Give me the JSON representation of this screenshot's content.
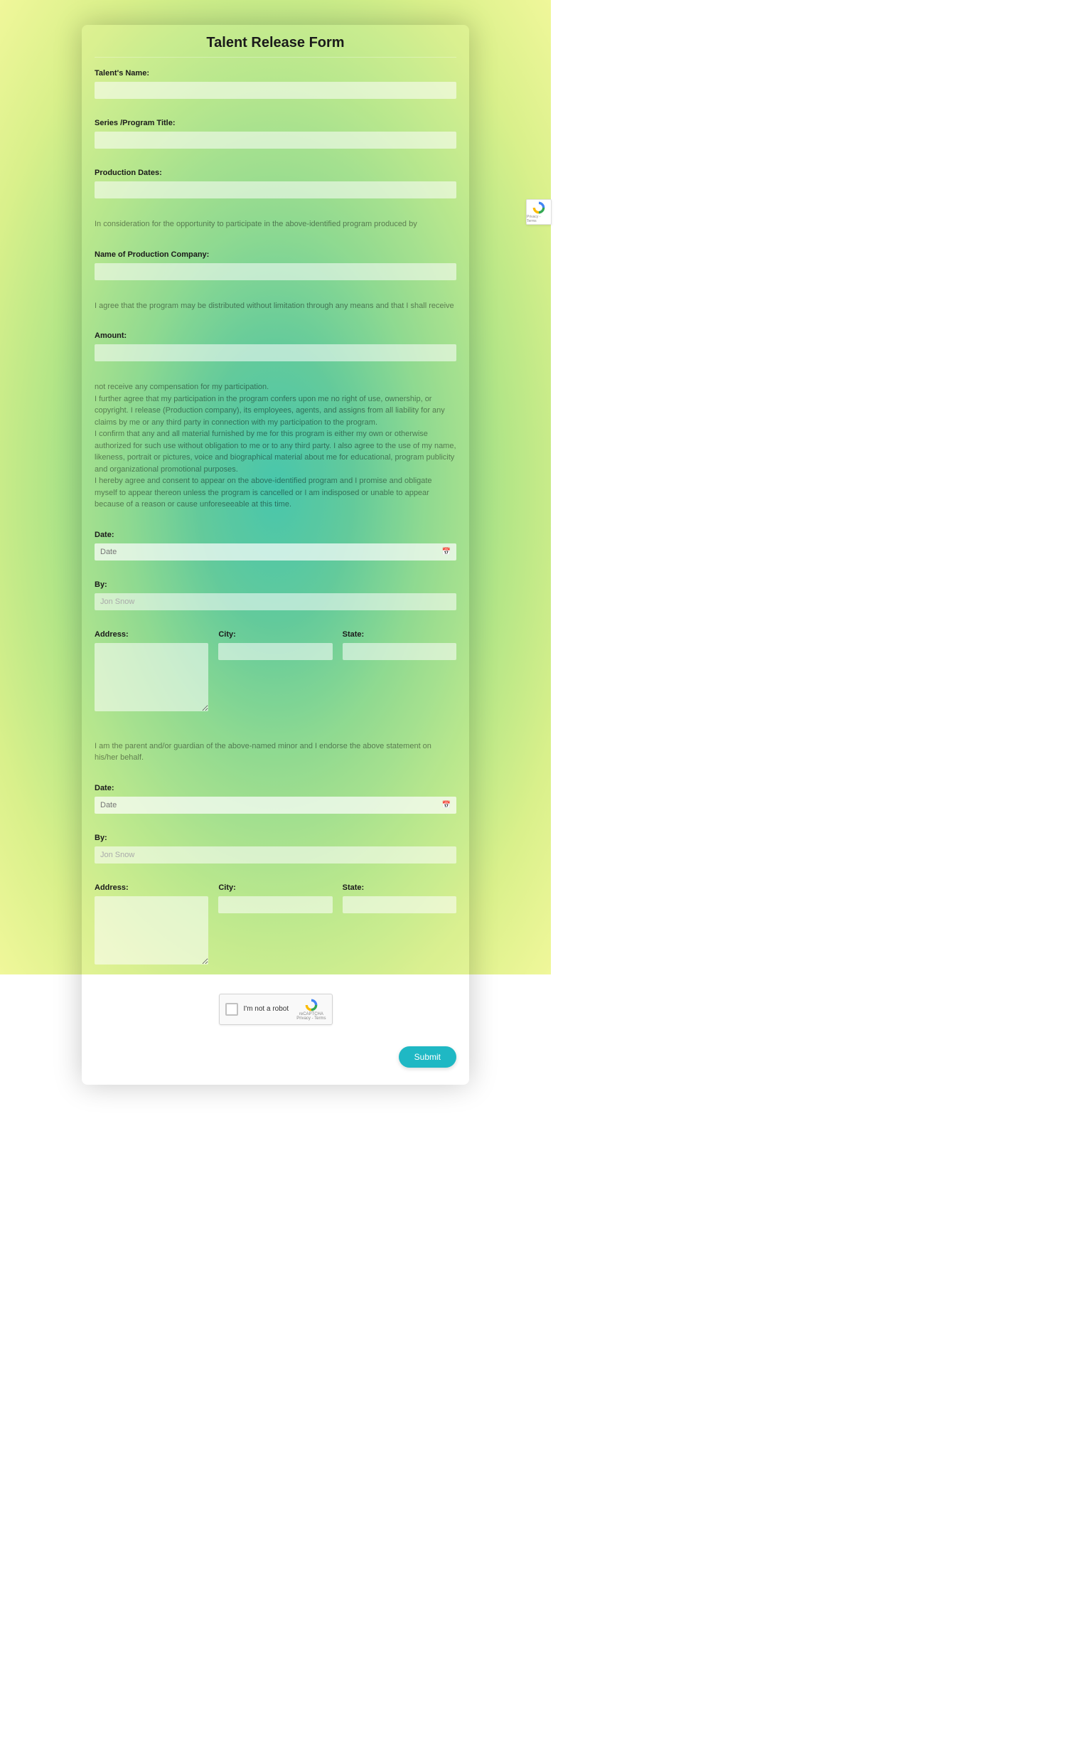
{
  "title": "Talent Release Form",
  "fields": {
    "talents_name": {
      "label": "Talent's Name:"
    },
    "series_title": {
      "label": "Series /Program Title:"
    },
    "production_dates": {
      "label": "Production Dates:"
    },
    "company": {
      "label": "Name of Production Company:"
    },
    "amount": {
      "label": "Amount:"
    },
    "date1": {
      "label": "Date:",
      "placeholder": "Date"
    },
    "by1": {
      "label": "By:",
      "placeholder": "Jon Snow"
    },
    "address1": {
      "label": "Address:"
    },
    "city1": {
      "label": "City:"
    },
    "state1": {
      "label": "State:"
    },
    "date2": {
      "label": "Date:",
      "placeholder": "Date"
    },
    "by2": {
      "label": "By:",
      "placeholder": "Jon Snow"
    },
    "address2": {
      "label": "Address:"
    },
    "city2": {
      "label": "City:"
    },
    "state2": {
      "label": "State:"
    }
  },
  "paragraphs": {
    "p1": "In consideration for the opportunity to participate in the above-identified program produced by",
    "p2": "I agree that the program may be distributed without limitation through any means and that I shall receive",
    "p3a": "not receive any compensation for my participation.",
    "p3b": "I further agree that my participation in the program confers upon me no right of use, ownership, or copyright. I release (Production company), its employees, agents, and assigns from all liability for any claims by me or any third party in connection with my participation to the program.",
    "p3c": "I confirm that any and all material furnished by me for this program is either my own or otherwise authorized for such use without obligation to me or to any third party. I also agree to the use of my name, likeness, portrait or pictures, voice and biographical material about me for educational, program publicity and organizational promotional purposes.",
    "p3d": "I hereby agree and consent to appear on the above-identified program and I promise and obligate myself to appear thereon unless the program is cancelled or I am indisposed or unable to appear because of a reason or cause unforeseeable at this time.",
    "p4": "I am the parent and/or guardian of the above-named minor and I endorse the above statement on his/her behalf."
  },
  "recaptcha": {
    "label": "I'm not a robot",
    "brand": "reCAPTCHA",
    "terms": "Privacy - Terms"
  },
  "submit": "Submit"
}
